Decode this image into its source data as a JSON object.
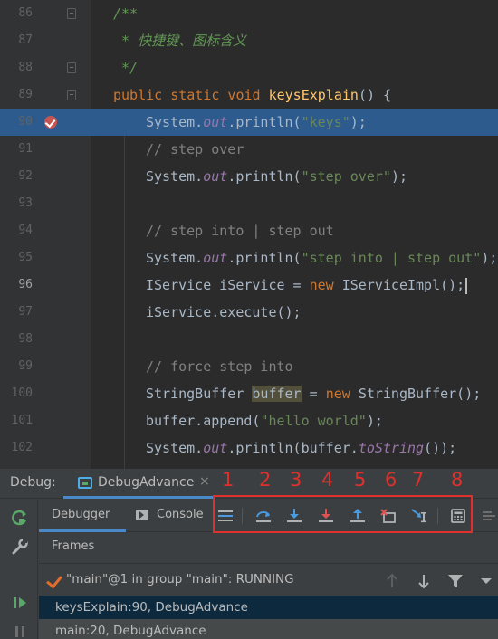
{
  "editor": {
    "lines": [
      {
        "num": "86",
        "tokens": [
          {
            "t": "/**",
            "c": "cmt"
          }
        ],
        "indent": 0
      },
      {
        "num": "87",
        "tokens": [
          {
            "t": " * 快捷键、图标含义",
            "c": "cmt"
          }
        ],
        "indent": 0
      },
      {
        "num": "88",
        "tokens": [
          {
            "t": " */",
            "c": "cmt"
          }
        ],
        "indent": 0
      },
      {
        "num": "89",
        "tokens": [
          {
            "t": "public static void ",
            "c": "kw"
          },
          {
            "t": "keysExplain",
            "c": "fn"
          },
          {
            "t": "() {",
            "c": ""
          }
        ],
        "indent": 0
      },
      {
        "num": "90",
        "tokens": [
          {
            "t": "System.",
            "c": ""
          },
          {
            "t": "out",
            "c": "fld"
          },
          {
            "t": ".println(",
            "c": ""
          },
          {
            "t": "\"keys\"",
            "c": "str"
          },
          {
            "t": ");",
            "c": ""
          }
        ],
        "indent": 1
      },
      {
        "num": "91",
        "tokens": [
          {
            "t": "// step over",
            "c": "lcmt"
          }
        ],
        "indent": 1
      },
      {
        "num": "92",
        "tokens": [
          {
            "t": "System.",
            "c": ""
          },
          {
            "t": "out",
            "c": "fld"
          },
          {
            "t": ".println(",
            "c": ""
          },
          {
            "t": "\"step over\"",
            "c": "str"
          },
          {
            "t": ");",
            "c": ""
          }
        ],
        "indent": 1
      },
      {
        "num": "93",
        "tokens": [],
        "indent": 1
      },
      {
        "num": "94",
        "tokens": [
          {
            "t": "// step into | step out",
            "c": "lcmt"
          }
        ],
        "indent": 1
      },
      {
        "num": "95",
        "tokens": [
          {
            "t": "System.",
            "c": ""
          },
          {
            "t": "out",
            "c": "fld"
          },
          {
            "t": ".println(",
            "c": ""
          },
          {
            "t": "\"step into | step out\"",
            "c": "str"
          },
          {
            "t": ");",
            "c": ""
          }
        ],
        "indent": 1
      },
      {
        "num": "96",
        "tokens": [
          {
            "t": "IService iService = ",
            "c": ""
          },
          {
            "t": "new ",
            "c": "kw"
          },
          {
            "t": "IServiceImpl();",
            "c": ""
          }
        ],
        "indent": 1
      },
      {
        "num": "97",
        "tokens": [
          {
            "t": "iService.execute();",
            "c": ""
          }
        ],
        "indent": 1
      },
      {
        "num": "98",
        "tokens": [],
        "indent": 1
      },
      {
        "num": "99",
        "tokens": [
          {
            "t": "// force step into",
            "c": "lcmt"
          }
        ],
        "indent": 1
      },
      {
        "num": "100",
        "tokens": [
          {
            "t": "StringBuffer ",
            "c": ""
          },
          {
            "t": "buffer",
            "c": "hlw"
          },
          {
            "t": " = ",
            "c": ""
          },
          {
            "t": "new ",
            "c": "kw"
          },
          {
            "t": "StringBuffer();",
            "c": ""
          }
        ],
        "indent": 1
      },
      {
        "num": "101",
        "tokens": [
          {
            "t": "buffer.append(",
            "c": ""
          },
          {
            "t": "\"hello world\"",
            "c": "str"
          },
          {
            "t": ");",
            "c": ""
          }
        ],
        "indent": 1
      },
      {
        "num": "102",
        "tokens": [
          {
            "t": "System.",
            "c": ""
          },
          {
            "t": "out",
            "c": "fld"
          },
          {
            "t": ".println(buffer.",
            "c": ""
          },
          {
            "t": "toString",
            "c": "fld"
          },
          {
            "t": "());",
            "c": ""
          }
        ],
        "indent": 1
      }
    ]
  },
  "debug": {
    "label": "Debug:",
    "tab_title": "DebugAdvance",
    "tab_close": "×",
    "annotations": [
      "1",
      "2",
      "3",
      "4",
      "5",
      "6",
      "7",
      "8"
    ],
    "subtabs": {
      "debugger": "Debugger",
      "console": "Console"
    },
    "frames_header": "Frames",
    "thread": "\"main\"@1 in group \"main\": RUNNING",
    "frames": [
      "keysExplain:90, DebugAdvance",
      "main:20, DebugAdvance"
    ]
  },
  "colors": {
    "accent": "#4a88c7",
    "annotation": "#e0302e",
    "selection": "#2d5b8e",
    "resume": "#59a869"
  }
}
